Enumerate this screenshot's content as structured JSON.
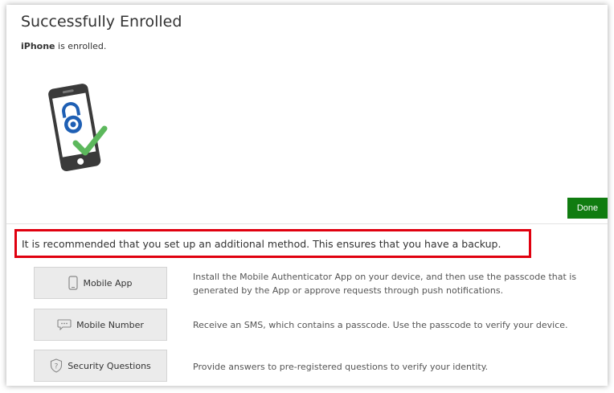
{
  "header": {
    "title": "Successfully Enrolled",
    "device_name": "iPhone",
    "device_status": " is enrolled."
  },
  "actions": {
    "done_label": "Done"
  },
  "recommendation": {
    "text": "It is recommended that you set up an additional method. This ensures that you have a backup."
  },
  "methods": [
    {
      "label": "Mobile App",
      "icon": "phone-icon",
      "description": "Install the Mobile Authenticator App on your device, and then use the passcode that is generated by the App or approve requests through push notifications."
    },
    {
      "label": "Mobile Number",
      "icon": "chat-bubble-icon",
      "description": "Receive an SMS, which contains a passcode. Use the passcode to verify your device."
    },
    {
      "label": "Security Questions",
      "icon": "shield-question-icon",
      "description": "Provide answers to pre-registered questions to verify your identity."
    }
  ],
  "colors": {
    "done_button": "#107c10",
    "highlight_border": "#e0000f",
    "lock_blue": "#1e5fb4",
    "check_green": "#5cb85c",
    "phone_body": "#3a3a3a"
  }
}
